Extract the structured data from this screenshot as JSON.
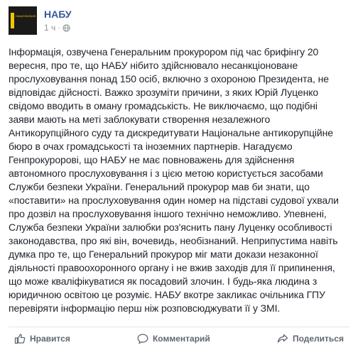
{
  "post": {
    "author": "НАБУ",
    "avatar_text": "НАЦІОНАЛЬНЕ АНТИКОРУПЦІЙНЕ БЮРО УКРАЇНИ",
    "time": "1 ч",
    "separator": "·",
    "lines": [
      "Інформація, озвучена Генеральним прокурором під час брифінгу 20",
      "вересня, про те, що НАБУ нібито здійснювало несанкціоноване",
      "прослуховування понад 150 осіб, включно з охороною Президента, не",
      "відповідає дійсності. Важко зрозуміти причини, з яких Юрій Луценко",
      "свідомо вводить в оману громадськість. Не виключаємо, що подібні",
      "заяви мають на меті заблокувати створення незалежного",
      "Антикорупційного суду та дискредитувати Національне антикорупційне",
      "бюро в очах громадськості та іноземних партнерів. Нагадуємо",
      "Генпрокуророві, що НАБУ не має повноважень для здійснення",
      "автономного прослуховування і з цією метою користується засобами",
      "Служби безпеки України. Генеральний прокурор мав би знати, що",
      "«поставити» на прослуховування один номер на підставі судової ухвали",
      "про дозвіл на прослуховування іншого технічно неможливо. Упевнені,",
      "Служба безпеки України залюбки роз'яснить пану Луценку особливості",
      "законодавства, про які він, вочевидь, необізнаний. Неприпустима навіть",
      "думка про те, що Генеральний прокурор міг мати докази незаконної",
      "діяльності правоохоронного органу і не вжив заходів для її припинення,",
      "що може кваліфікуватися як посадовий злочин. І будь-яка людина з",
      "юридичною освітою це розуміє. НАБУ вкотре закликає очільника ГПУ",
      "перевіряти інформацію перш ніж розповсюджувати її у ЗМІ."
    ]
  },
  "actions": {
    "like": "Нравится",
    "comment": "Комментарий",
    "share": "Поделиться"
  },
  "colors": {
    "author": "#365899",
    "meta": "#90949c",
    "action": "#606770",
    "brand_yellow": "#f5c400"
  }
}
